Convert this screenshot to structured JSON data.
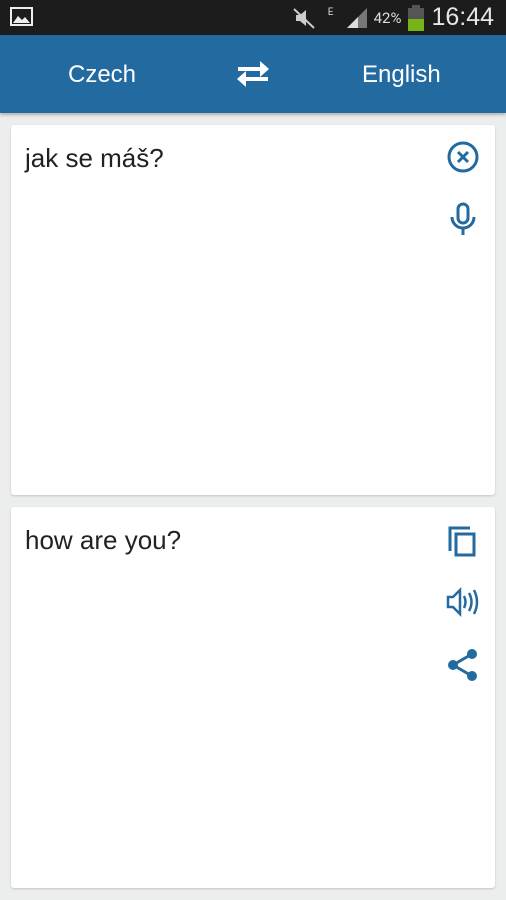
{
  "status_bar": {
    "time": "16:44",
    "battery": "42%",
    "network": "E"
  },
  "header": {
    "source_language": "Czech",
    "target_language": "English"
  },
  "input": {
    "text": "jak se máš?"
  },
  "output": {
    "text": "how are you?"
  },
  "colors": {
    "accent": "#236aa0",
    "icon": "#236aa0",
    "background": "#eceeee"
  },
  "icons": [
    "clear-icon",
    "microphone-icon",
    "copy-icon",
    "speaker-icon",
    "share-icon",
    "swap-icon"
  ]
}
